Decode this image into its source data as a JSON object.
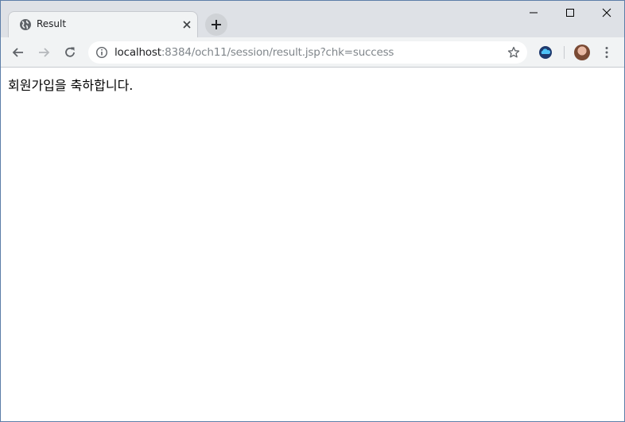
{
  "tab": {
    "title": "Result",
    "favicon": "globe-icon"
  },
  "address_bar": {
    "host": "localhost",
    "path": ":8384/och11/session/result.jsp?chk=success"
  },
  "page": {
    "message": "회원가입을 축하합니다."
  },
  "colors": {
    "titlebar": "#dee1e6",
    "toolbar": "#f1f3f4",
    "window_border": "#5d7ea8"
  }
}
